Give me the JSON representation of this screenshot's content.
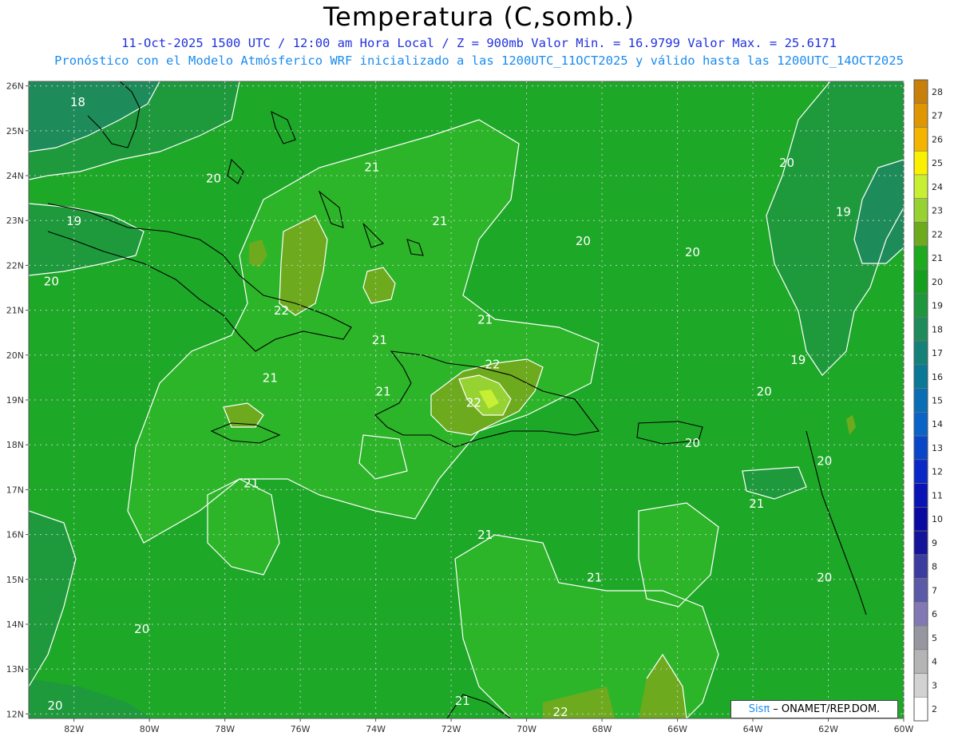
{
  "title": "Temperatura (C,somb.)",
  "subtitle_line1": "11-Oct-2025  1500 UTC / 12:00 am Hora Local / Z = 900mb   Valor Min. = 16.9799  Valor Max. = 25.6171",
  "subtitle_line2": "Pronóstico con el Modelo Atmósferico WRF inicializado a las 1200UTC_11OCT2025 y válido hasta las  1200UTC_14OCT2025",
  "watermark": {
    "brand": "Sisπ",
    "text": " – ONAMET/REP.DOM."
  },
  "map": {
    "lon_range": [
      -83.2,
      -60.0
    ],
    "lat_range": [
      11.9,
      26.1
    ],
    "x_ticks": [
      "82W",
      "80W",
      "78W",
      "76W",
      "74W",
      "72W",
      "70W",
      "68W",
      "66W",
      "64W",
      "62W",
      "60W"
    ],
    "y_ticks": [
      "12N",
      "13N",
      "14N",
      "15N",
      "16N",
      "17N",
      "18N",
      "19N",
      "20N",
      "21N",
      "22N",
      "23N",
      "24N",
      "25N",
      "26N"
    ],
    "grid": true
  },
  "colorbar": {
    "levels": [
      {
        "label": "28",
        "color": "#c8800a"
      },
      {
        "label": "27",
        "color": "#e09600"
      },
      {
        "label": "26",
        "color": "#f5b400"
      },
      {
        "label": "25",
        "color": "#faf000"
      },
      {
        "label": "24",
        "color": "#c8f032"
      },
      {
        "label": "23",
        "color": "#96d232"
      },
      {
        "label": "22",
        "color": "#6eaa1e"
      },
      {
        "label": "21",
        "color": "#1eaa1e"
      },
      {
        "label": "20",
        "color": "#14a01e"
      },
      {
        "label": "19",
        "color": "#1e963c"
      },
      {
        "label": "18",
        "color": "#1e8c5a"
      },
      {
        "label": "17",
        "color": "#148278"
      },
      {
        "label": "16",
        "color": "#0a7896"
      },
      {
        "label": "15",
        "color": "#0a6eb4"
      },
      {
        "label": "14",
        "color": "#0a64c8"
      },
      {
        "label": "13",
        "color": "#0a46c8"
      },
      {
        "label": "12",
        "color": "#0a28c8"
      },
      {
        "label": "11",
        "color": "#0a14b4"
      },
      {
        "label": "10",
        "color": "#0a0aa0"
      },
      {
        "label": "9",
        "color": "#14149b"
      },
      {
        "label": "8",
        "color": "#3c3ca0"
      },
      {
        "label": "7",
        "color": "#5a5aa8"
      },
      {
        "label": "6",
        "color": "#8278b4"
      },
      {
        "label": "5",
        "color": "#9696a0"
      },
      {
        "label": "4",
        "color": "#b4b4b4"
      },
      {
        "label": "3",
        "color": "#d2d2d2"
      },
      {
        "label": "2",
        "color": "#ffffff"
      }
    ]
  },
  "contour_labels": [
    {
      "text": "18",
      "lon": -81.9,
      "lat": 25.55
    },
    {
      "text": "20",
      "lon": -78.3,
      "lat": 23.85
    },
    {
      "text": "21",
      "lon": -74.1,
      "lat": 24.1
    },
    {
      "text": "19",
      "lon": -82.0,
      "lat": 22.9
    },
    {
      "text": "21",
      "lon": -72.3,
      "lat": 22.9
    },
    {
      "text": "20",
      "lon": -68.5,
      "lat": 22.45
    },
    {
      "text": "20",
      "lon": -65.6,
      "lat": 22.2
    },
    {
      "text": "20",
      "lon": -63.1,
      "lat": 24.2
    },
    {
      "text": "19",
      "lon": -61.6,
      "lat": 23.1
    },
    {
      "text": "20",
      "lon": -82.6,
      "lat": 21.55
    },
    {
      "text": "22",
      "lon": -76.5,
      "lat": 20.9
    },
    {
      "text": "21",
      "lon": -71.1,
      "lat": 20.7
    },
    {
      "text": "21",
      "lon": -73.9,
      "lat": 20.25
    },
    {
      "text": "22",
      "lon": -70.9,
      "lat": 19.7
    },
    {
      "text": "19",
      "lon": -62.8,
      "lat": 19.8
    },
    {
      "text": "21",
      "lon": -76.8,
      "lat": 19.4
    },
    {
      "text": "21",
      "lon": -73.8,
      "lat": 19.1
    },
    {
      "text": "22",
      "lon": -71.4,
      "lat": 18.85
    },
    {
      "text": "20",
      "lon": -63.7,
      "lat": 19.1
    },
    {
      "text": "20",
      "lon": -65.6,
      "lat": 17.95
    },
    {
      "text": "20",
      "lon": -62.1,
      "lat": 17.55
    },
    {
      "text": "21",
      "lon": -77.3,
      "lat": 17.05
    },
    {
      "text": "21",
      "lon": -63.9,
      "lat": 16.6
    },
    {
      "text": "21",
      "lon": -71.1,
      "lat": 15.9
    },
    {
      "text": "21",
      "lon": -68.2,
      "lat": 14.95
    },
    {
      "text": "20",
      "lon": -62.1,
      "lat": 14.95
    },
    {
      "text": "20",
      "lon": -80.2,
      "lat": 13.8
    },
    {
      "text": "20",
      "lon": -82.5,
      "lat": 12.1
    },
    {
      "text": "21",
      "lon": -71.7,
      "lat": 12.2
    },
    {
      "text": "22",
      "lon": -69.1,
      "lat": 11.95
    }
  ]
}
